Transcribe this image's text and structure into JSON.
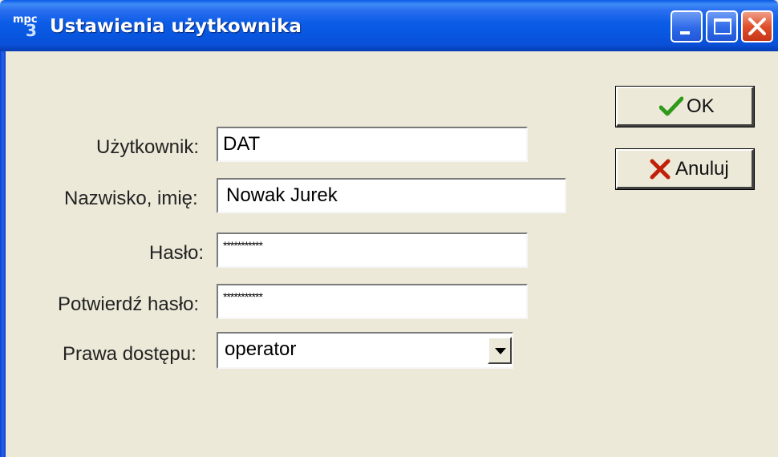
{
  "window": {
    "title": "Ustawienia użytkownika",
    "app_icon_text_small": "mpc",
    "app_icon_text_big": "3",
    "controls": [
      "minimize",
      "maximize",
      "close"
    ]
  },
  "form": {
    "user": {
      "label": "Użytkownik:",
      "value": "DAT"
    },
    "name": {
      "label": "Nazwisko, imię:",
      "value": "Nowak Jurek"
    },
    "password": {
      "label": "Hasło:",
      "value": "***********"
    },
    "password_confirm": {
      "label": "Potwierdź hasło:",
      "value": "***********"
    },
    "access": {
      "label": "Prawa dostępu:",
      "value": "operator"
    }
  },
  "buttons": {
    "ok": {
      "label": "OK",
      "icon": "checkmark-icon",
      "color": "#2f9a1a"
    },
    "cancel": {
      "label": "Anuluj",
      "icon": "x-icon",
      "color": "#c0200a"
    }
  }
}
